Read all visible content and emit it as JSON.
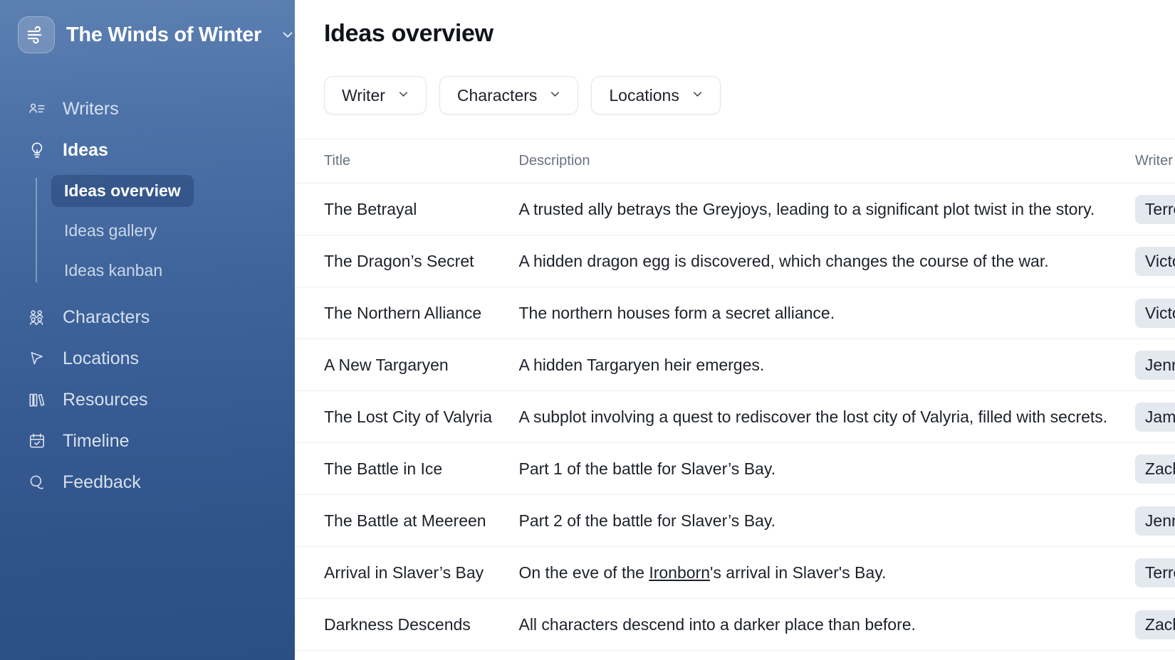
{
  "sidebar": {
    "brand": {
      "title": "The Winds of Winter",
      "logo_icon": "wind-icon",
      "caret_icon": "chevron-down-icon"
    },
    "items": [
      {
        "label": "Writers",
        "icon": "user-list-icon",
        "active": false
      },
      {
        "label": "Ideas",
        "icon": "lightbulb-icon",
        "active": true
      },
      {
        "label": "Characters",
        "icon": "users-icon",
        "active": false
      },
      {
        "label": "Locations",
        "icon": "cursor-arrow-icon",
        "active": false
      },
      {
        "label": "Resources",
        "icon": "books-icon",
        "active": false
      },
      {
        "label": "Timeline",
        "icon": "calendar-check-icon",
        "active": false
      },
      {
        "label": "Feedback",
        "icon": "chat-bubbles-icon",
        "active": false
      }
    ],
    "subnav": [
      {
        "label": "Ideas overview",
        "active": true
      },
      {
        "label": "Ideas gallery",
        "active": false
      },
      {
        "label": "Ideas kanban",
        "active": false
      }
    ]
  },
  "main": {
    "page_title": "Ideas overview",
    "filters": [
      {
        "label": "Writer",
        "icon": "chevron-down-icon"
      },
      {
        "label": "Characters",
        "icon": "chevron-down-icon"
      },
      {
        "label": "Locations",
        "icon": "chevron-down-icon"
      }
    ],
    "table": {
      "columns": [
        "Title",
        "Description",
        "Writer"
      ],
      "rows": [
        {
          "title": "The Betrayal",
          "description": "A trusted ally betrays the Greyjoys, leading to a significant plot twist in the story.",
          "writer": "Terrence Brooks"
        },
        {
          "title": "The Dragon’s Secret",
          "description": "A hidden dragon egg is discovered, which changes the course of the war.",
          "writer": "Victoria Ahn"
        },
        {
          "title": "The Northern Alliance",
          "description": "The northern houses form a secret alliance.",
          "writer": "Victoria Ahn"
        },
        {
          "title": "A New Targaryen",
          "description": "A hidden Targaryen heir emerges.",
          "writer": "Jennifer Hong"
        },
        {
          "title": "The Lost City of Valyria",
          "description": "A subplot involving a quest to rediscover the lost city of Valyria, filled with secrets.",
          "writer": "James Tisdale"
        },
        {
          "title": "The Battle in Ice",
          "description": "Part 1 of the battle for Slaver’s Bay.",
          "writer": "Zachary Goldberg"
        },
        {
          "title": "The Battle at Meereen",
          "description": "Part 2 of the battle for Slaver’s Bay.",
          "writer": "Jennifer Hong"
        },
        {
          "title": "Arrival in Slaver’s Bay",
          "description_pre": "On the eve of the ",
          "description_link": "Ironborn",
          "description_post": "'s arrival in Slaver's Bay.",
          "writer": "Terrence Brooks"
        },
        {
          "title": "Darkness Descends",
          "description": "All characters descend into a darker place than before.",
          "writer": "Zachary Goldberg"
        }
      ]
    }
  },
  "colors": {
    "sidebar_top": "#5d80b2",
    "sidebar_bottom": "#2c4f83",
    "badge_bg": "#e4e8ef",
    "text_primary": "#1d2129",
    "text_muted": "#6a7280",
    "border": "#eceef1"
  }
}
